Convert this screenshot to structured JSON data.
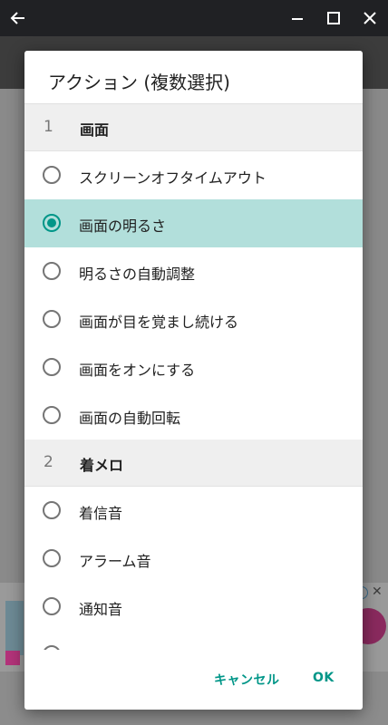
{
  "dialog": {
    "title": "アクション (複数選択)",
    "sections": [
      {
        "number": "1",
        "label": "画面",
        "items": [
          {
            "label": "スクリーンオフタイムアウト",
            "selected": false
          },
          {
            "label": "画面の明るさ",
            "selected": true
          },
          {
            "label": "明るさの自動調整",
            "selected": false
          },
          {
            "label": "画面が目を覚まし続ける",
            "selected": false
          },
          {
            "label": "画面をオンにする",
            "selected": false
          },
          {
            "label": "画面の自動回転",
            "selected": false
          }
        ]
      },
      {
        "number": "2",
        "label": "着メロ",
        "items": [
          {
            "label": "着信音",
            "selected": false
          },
          {
            "label": "アラーム音",
            "selected": false
          },
          {
            "label": "通知音",
            "selected": false
          },
          {
            "label": "",
            "selected": false
          }
        ]
      }
    ],
    "cancel_label": "キャンセル",
    "ok_label": "OK"
  },
  "colors": {
    "accent": "#009688",
    "selected_row": "#b2dfdb",
    "section_bg": "#efefef",
    "titlebar": "#202124"
  },
  "icons": {
    "back": "arrow-back-icon",
    "minimize": "minimize-icon",
    "maximize": "maximize-icon",
    "close": "close-icon"
  }
}
